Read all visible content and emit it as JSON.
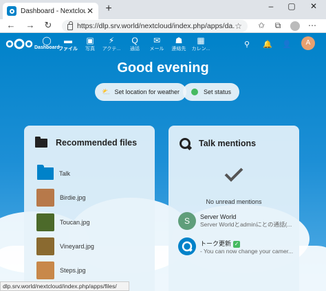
{
  "browser": {
    "tab_title": "Dashboard - Nextcloud",
    "tab_close": "✕",
    "new_tab": "+",
    "window_controls": [
      "–",
      "▢",
      "✕"
    ],
    "url": "https://dlp.srv.world/nextcloud/index.php/apps/da...",
    "status_url": "dlp.srv.world/nextcloud/index.php/apps/files/"
  },
  "nextcloud": {
    "apps": [
      {
        "label": "Dashboard",
        "icon": "dashboard-icon"
      },
      {
        "label": "ファイル",
        "icon": "folder-icon"
      },
      {
        "label": "写真",
        "icon": "image-icon"
      },
      {
        "label": "アクテ...",
        "icon": "activity-icon"
      },
      {
        "label": "通話",
        "icon": "talk-icon"
      },
      {
        "label": "メール",
        "icon": "mail-icon"
      },
      {
        "label": "連絡先",
        "icon": "contacts-icon"
      },
      {
        "label": "カレン...",
        "icon": "calendar-icon"
      }
    ],
    "avatar_letter": "A",
    "greeting": "Good evening",
    "weather_button": "Set location for weather",
    "status_button": "Set status",
    "recommended": {
      "title": "Recommended files",
      "files": [
        {
          "name": "Talk",
          "type": "folder"
        },
        {
          "name": "Birdie.jpg",
          "type": "image",
          "color": "#b7794a"
        },
        {
          "name": "Toucan.jpg",
          "type": "image",
          "color": "#4c6a2a"
        },
        {
          "name": "Vineyard.jpg",
          "type": "image",
          "color": "#8a6a30"
        },
        {
          "name": "Steps.jpg",
          "type": "image",
          "color": "#c8884a"
        }
      ]
    },
    "talk": {
      "title": "Talk mentions",
      "empty": "No unread mentions",
      "mentions": [
        {
          "title": "Server World",
          "subtitle": "Server Worldとadminにとの通話(...",
          "avatar_letter": "S",
          "avatar_color": "#5f9e7a"
        },
        {
          "title": "トーク更新",
          "subtitle": "- You can now change your camer...",
          "avatar_letter": "",
          "avatar_color": "#0082c9",
          "badge": "✓"
        }
      ]
    }
  },
  "colors": {
    "brand": "#0082c9",
    "status_online": "#46ba61"
  }
}
